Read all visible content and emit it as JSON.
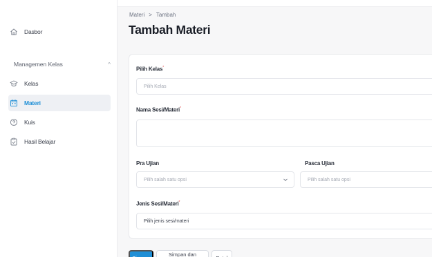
{
  "sidebar": {
    "dashboard": "Dasbor",
    "section_title": "Managemen Kelas",
    "items": [
      {
        "label": "Kelas",
        "icon": "graduation-cap-icon"
      },
      {
        "label": "Materi",
        "icon": "calendar-icon"
      },
      {
        "label": "Kuis",
        "icon": "question-icon"
      },
      {
        "label": "Hasil Belajar",
        "icon": "clipboard-check-icon"
      }
    ],
    "active_item": "Materi"
  },
  "breadcrumb": {
    "parent": "Materi",
    "separator": ">",
    "current": "Tambah"
  },
  "page_title": "Tambah Materi",
  "form": {
    "kelas_label": "Pilih Kelas",
    "kelas_placeholder": "Pilih Kelas",
    "nama_label": "Nama Sesi/Materi",
    "nama_value": "",
    "pra_label": "Pra Ujian",
    "pra_placeholder": "Pilih salah satu opsi",
    "pasca_label": "Pasca Ujian",
    "pasca_placeholder": "Pilih salah satu opsi",
    "jenis_label": "Jenis Sesi/Materi",
    "jenis_value": "Pilih jenis sesi/materi",
    "required_mark": "*"
  },
  "buttons": {
    "save": "Simpan",
    "save_add": "Simpan dan tambah",
    "cancel": "Batal"
  },
  "colors": {
    "accent": "#1f8fd6",
    "active_bg": "#eef0f4",
    "required": "#e04848"
  }
}
